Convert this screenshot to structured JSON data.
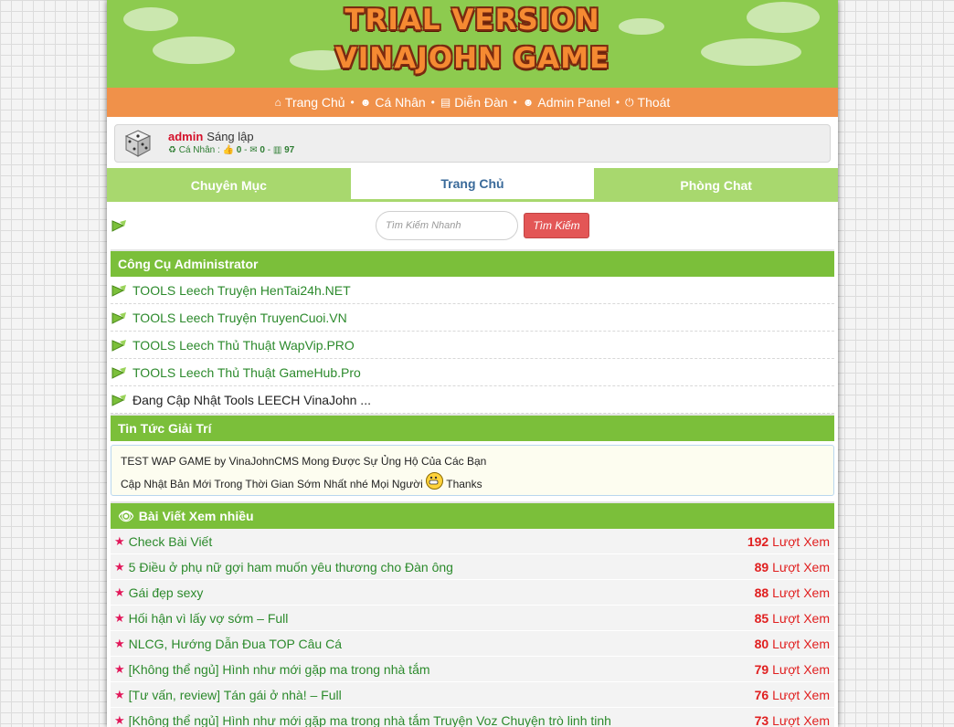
{
  "banner": {
    "line1": "TRIAL VERSION",
    "line2": "VINAJOHN GAME"
  },
  "nav": [
    {
      "icon": "home-icon",
      "glyph": "⌂",
      "label": "Trang Chủ"
    },
    {
      "icon": "user-icon",
      "glyph": "☻",
      "label": "Cá Nhân"
    },
    {
      "icon": "book-icon",
      "glyph": "▤",
      "label": "Diễn Đàn"
    },
    {
      "icon": "user-icon",
      "glyph": "☻",
      "label": "Admin Panel"
    },
    {
      "icon": "power-icon",
      "glyph": "⏻",
      "label": "Thoát"
    }
  ],
  "profile": {
    "username": "admin",
    "role": "Sáng lập",
    "stats_label": "Cá Nhân :",
    "likes": "0",
    "messages": "0",
    "posts": "97"
  },
  "tabs": [
    {
      "label": "Chuyên Mục"
    },
    {
      "label": "Trang Chủ"
    },
    {
      "label": "Phòng Chat"
    }
  ],
  "search": {
    "placeholder": "Tìm Kiếm Nhanh",
    "button": "Tìm Kiếm"
  },
  "admin_tools": {
    "title": "Công Cụ Administrator",
    "items": [
      "TOOLS Leech Truyện HenTai24h.NET",
      "TOOLS Leech Truyện TruyenCuoi.VN",
      "TOOLS Leech Thủ Thuật WapVip.PRO",
      "TOOLS Leech Thủ Thuật GameHub.Pro",
      "Đang Cập Nhật Tools LEECH VinaJohn ..."
    ]
  },
  "news": {
    "title": "Tin Tức Giải Trí",
    "line1": "TEST WAP GAME by VinaJohnCMS Mong Được Sự Ủng Hộ Của Các Bạn",
    "line2": "Cập Nhật Bản Mới Trong Thời Gian Sớm Nhất nhé Mọi Người",
    "thanks": "Thanks"
  },
  "popular": {
    "title": "Bài Viết Xem nhiều",
    "views_label": "Lượt Xem",
    "items": [
      {
        "title": "Check Bài Viết",
        "views": "192"
      },
      {
        "title": "5 Điều ở phụ nữ gợi ham muốn yêu thương cho Đàn ông",
        "views": "89"
      },
      {
        "title": "Gái đẹp sexy",
        "views": "88"
      },
      {
        "title": "Hối hận vì lấy vợ sớm – Full",
        "views": "85"
      },
      {
        "title": "NLCG, Hướng Dẫn Đua TOP Câu Cá",
        "views": "80"
      },
      {
        "title": "[Không thể ngủ] Hình như mới gặp ma trong nhà tắm",
        "views": "79"
      },
      {
        "title": "[Tư vấn, review] Tán gái ở nhà! – Full",
        "views": "76"
      },
      {
        "title": "[Không thể ngủ] Hình như mới gặp ma trong nhà tắm Truyện Voz Chuyện trò linh tinh",
        "views": "73"
      }
    ]
  },
  "colors": {
    "banner": "#8dcb4f",
    "nav": "#f0914a",
    "section": "#7bbf3a",
    "tab": "#a8d86e",
    "link": "#2c8a2c",
    "views": "#e01f1f"
  }
}
